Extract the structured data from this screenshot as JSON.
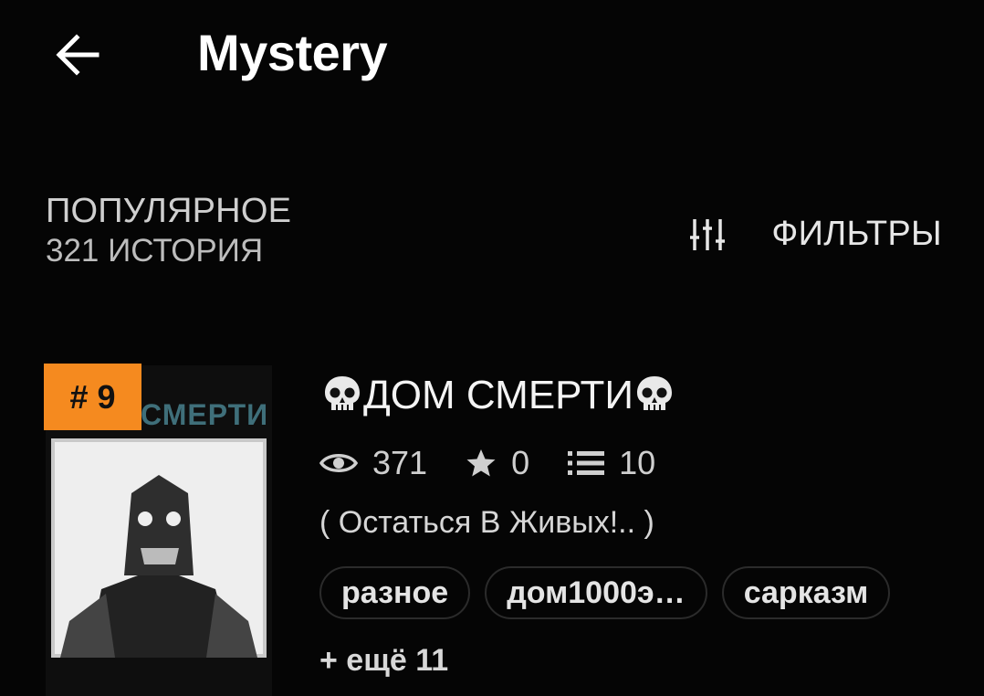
{
  "header": {
    "back_icon": "arrow-left-icon",
    "title": "Mystery"
  },
  "section": {
    "title": "ПОПУЛЯРНОЕ",
    "count": "321 ИСТОРИЯ"
  },
  "filters": {
    "icon": "sliders-icon",
    "label": "ФИЛЬТРЫ"
  },
  "story": {
    "rank": "# 9",
    "cover_text": "СМЕРТИ",
    "title_prefix": "💀",
    "title": "ДОМ СМЕРТИ",
    "title_suffix": "💀",
    "stats": {
      "views": "371",
      "votes": "0",
      "parts": "10"
    },
    "description": "(  Остаться В Живых!.. )",
    "tags": [
      "разное",
      "дом1000э…",
      "сарказм"
    ],
    "more_tags": "+ ещё 11"
  },
  "colors": {
    "background": "#050505",
    "badge": "#f58a1f",
    "tag_border": "#2b2b2b"
  }
}
